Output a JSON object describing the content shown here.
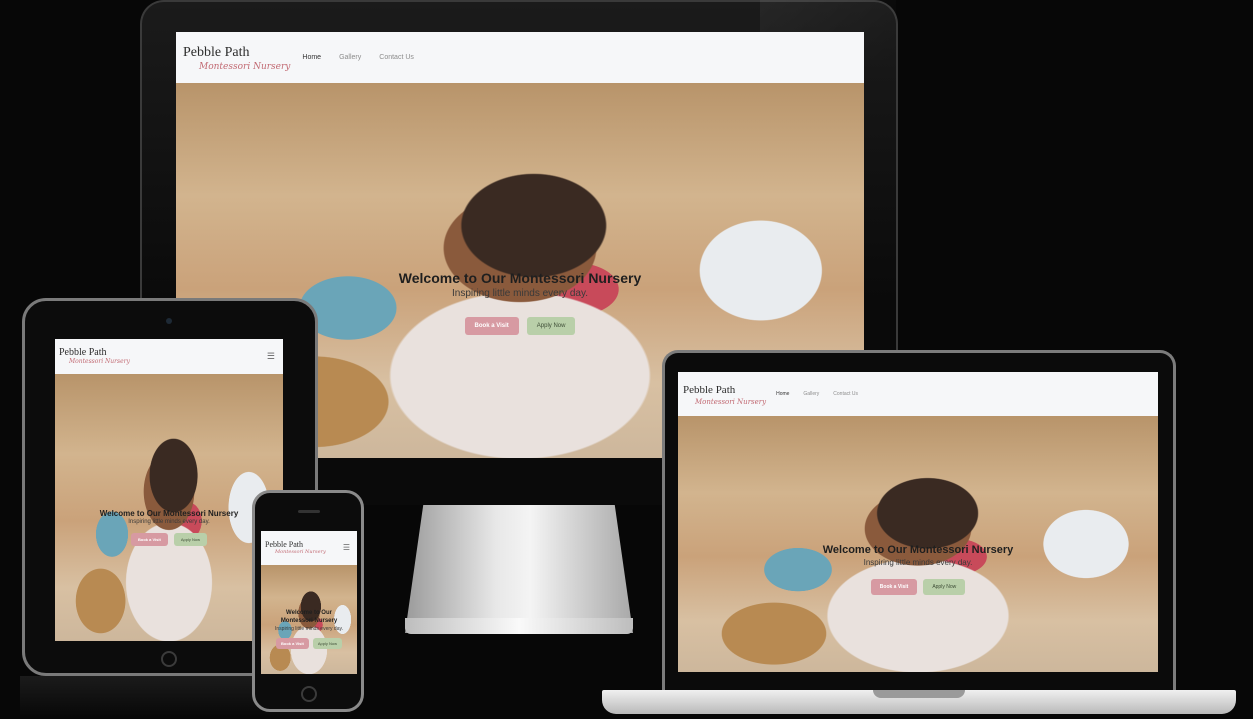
{
  "site": {
    "brand_name": "Pebble Path",
    "brand_subtitle": "Montessori Nursery",
    "nav": [
      "Home",
      "Gallery",
      "Contact Us"
    ],
    "menu_icon": "hamburger-icon",
    "hero": {
      "title": "Welcome to Our Montessori Nursery",
      "subtitle": "Inspiring little minds every day.",
      "visit_button": "Book a Visit",
      "apply_button": "Apply Now"
    }
  },
  "colors": {
    "page_bg": "#070707",
    "nav_bg": "#f6f7f9",
    "brand_subtitle": "#c26a73",
    "visit_button": "#d79aa2",
    "apply_button": "#b9cfa9"
  }
}
